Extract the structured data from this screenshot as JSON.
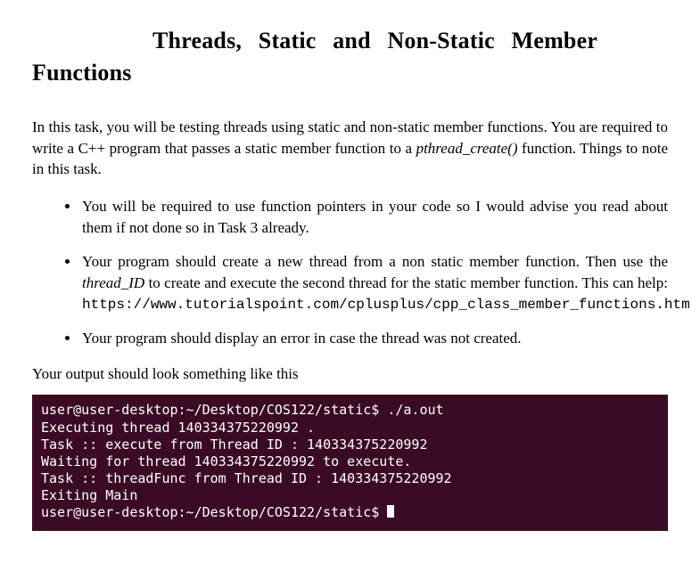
{
  "title": {
    "line1": "Threads, Static and Non-Static Member",
    "line2": "Functions"
  },
  "intro": {
    "p1a": "In this task, you will be testing threads using static and non-static member functions. You are required to write a C++ program that passes a static member function to a ",
    "p1_func": "pthread_create()",
    "p1b": " function. Things to note in this task."
  },
  "bullets": {
    "b1": "You will be required to use function pointers in your code so I would advise you read about them if not done so in Task 3 already.",
    "b2a": "Your program should create a new thread from a non static member function. Then use the ",
    "b2_var": "thread_ID",
    "b2b": " to create and execute the second thread for the static member function. This can help: ",
    "b2_url": "https://www.tutorialspoint.com/cplusplus/cpp_class_member_functions.htm",
    "b3": "Your program should display an error in case the thread was not created."
  },
  "output_label": "Your output should look something like this",
  "terminal": {
    "prompt": "user@user-desktop:~/Desktop/COS122/static$",
    "cmd": "./a.out",
    "l1": "Executing thread 140334375220992 .",
    "l2": "Task :: execute from Thread ID : 140334375220992",
    "l3": "Waiting for thread 140334375220992 to execute.",
    "l4": "Task :: threadFunc from Thread ID : 140334375220992",
    "l5": "Exiting Main"
  }
}
